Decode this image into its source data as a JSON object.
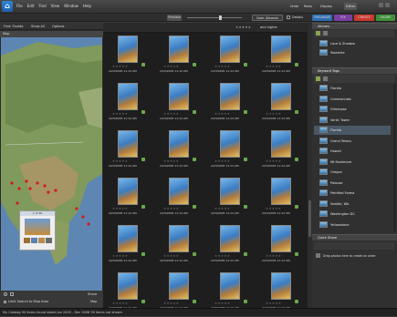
{
  "menu": [
    "File",
    "Edit",
    "Find",
    "View",
    "Window",
    "Help"
  ],
  "top_right": {
    "undo": "Undo",
    "redo": "Redo",
    "display": "Display",
    "editor": "Editor"
  },
  "tabs": {
    "organize": "ORGANIZE",
    "fix": "FIX",
    "create": "CREATE",
    "share": "SHARE"
  },
  "toolbar": {
    "sort": "Date (Newest First)",
    "details": "Details",
    "preview": "Preview"
  },
  "left_panel": {
    "tabs": [
      "Find: Florida",
      "Show All",
      "Options"
    ],
    "map_title": "Map",
    "popup_title": "1 of 90",
    "limit_search": "Limit Search to Map Area",
    "share_label": "Share",
    "map_label": "Map"
  },
  "grid": {
    "header_right": "and higher",
    "thumbs": [
      {
        "date": "2/23/2005 11:12 AM"
      },
      {
        "date": "2/23/2005 11:12 AM"
      },
      {
        "date": "2/23/2005 11:12 AM"
      },
      {
        "date": "2/23/2005 11:12 AM"
      },
      {
        "date": "2/23/2005 11:12 AM"
      },
      {
        "date": "2/23/2005 11:12 AM"
      },
      {
        "date": "2/23/2005 11:12 AM"
      },
      {
        "date": "2/23/2005 11:12 AM"
      },
      {
        "date": "2/23/2005 11:12 AM"
      },
      {
        "date": "2/23/2005 11:12 AM"
      },
      {
        "date": "2/23/2005 11:12 AM"
      },
      {
        "date": "2/23/2005 11:12 AM"
      },
      {
        "date": "2/23/2005 11:12 AM"
      },
      {
        "date": "2/23/2005 11:12 AM"
      },
      {
        "date": "2/23/2005 11:12 AM"
      },
      {
        "date": "2/23/2005 11:12 AM"
      },
      {
        "date": "2/23/2005 11:12 AM"
      },
      {
        "date": "2/23/2005 11:12 AM"
      },
      {
        "date": "2/23/2005 11:12 AM"
      },
      {
        "date": "2/23/2005 11:12 AM"
      },
      {
        "date": "2/23/2005 11:12 AM"
      },
      {
        "date": "2/23/2005 11:12 AM"
      },
      {
        "date": "2/23/2005 11:12 AM"
      },
      {
        "date": "2/23/2005 11:12 AM"
      }
    ]
  },
  "right_panel": {
    "albums_header": "Albums",
    "albums": [
      "Lace & Shadow",
      "Yosemite"
    ],
    "keywords_header": "Keyword Tags",
    "keywords": [
      "Florida",
      "Commercials",
      "Glimmpse",
      "Vertic Tower",
      "Florida",
      "Grand Tetons",
      "Hawaii",
      "Mt Rushmore",
      "Oregon",
      "Palouse",
      "Petrified Forest",
      "Seattle, WA",
      "Washington DC",
      "Yellowstone"
    ],
    "selected_keyword_index": 4,
    "quick_share_header": "Quick Share",
    "quick_share_hint": "Drag photos here to create an order"
  },
  "status": "My Catalog    90 items found dated Jan 2005 - Dec 2006    90 items not shown"
}
